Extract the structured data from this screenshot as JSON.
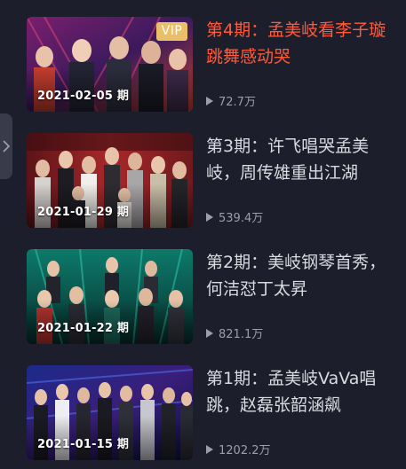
{
  "colors": {
    "background": "#1d1e2c",
    "active_title": "#ff5a3a",
    "title": "#d9dae0",
    "meta": "#9d9ea8",
    "vip_badge": "#e9c069"
  },
  "sidebar_toggle": {
    "icon": "chevron-right-icon"
  },
  "episodes": [
    {
      "title": "第4期：孟美岐看李子璇跳舞感动哭",
      "date": "2021-02-05 期",
      "plays": "72.7万",
      "badge": "VIP",
      "active": true
    },
    {
      "title": "第3期：许飞唱哭孟美岐，周传雄重出江湖",
      "date": "2021-01-29 期",
      "plays": "539.4万",
      "active": false
    },
    {
      "title": "第2期：美岐钢琴首秀，何洁怼丁太昇",
      "date": "2021-01-22 期",
      "plays": "821.1万",
      "active": false
    },
    {
      "title": "第1期：孟美岐VaVa唱跳，赵磊张韶涵飙",
      "date": "2021-01-15 期",
      "plays": "1202.2万",
      "active": false
    }
  ]
}
